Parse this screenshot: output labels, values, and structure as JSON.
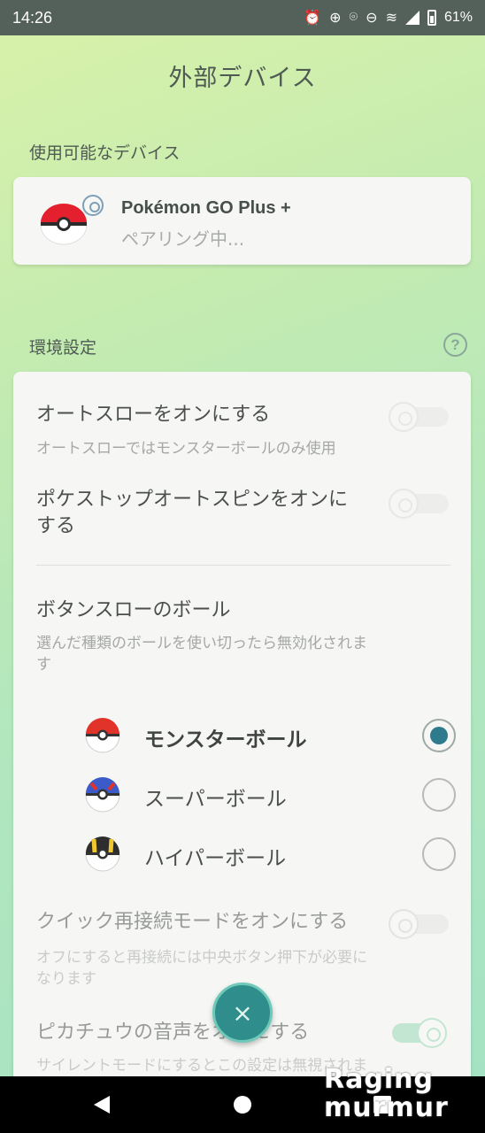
{
  "status_bar": {
    "time": "14:26",
    "battery": "61%",
    "icons": [
      "alarm-icon",
      "data-saver-icon",
      "location-icon",
      "do-not-disturb-icon",
      "wifi-icon",
      "signal-icon",
      "battery-icon"
    ]
  },
  "page": {
    "title": "外部デバイス"
  },
  "available_devices": {
    "label": "使用可能なデバイス",
    "device": {
      "name": "Pokémon GO Plus +",
      "status": "ペアリング中..."
    }
  },
  "settings": {
    "label": "環境設定",
    "help": "?",
    "auto_throw": {
      "title": "オートスローをオンにする",
      "desc": "オートスローではモンスターボールのみ使用",
      "enabled": false
    },
    "auto_spin": {
      "title_line1": "ポケストップオートスピンをオンに",
      "title_line2": "する",
      "enabled": false
    },
    "button_ball": {
      "title": "ボタンスローのボール",
      "desc_line1": "選んだ種類のボールを使い切ったら無効化されま",
      "desc_line2": "す",
      "options": [
        {
          "label": "モンスターボール",
          "selected": true
        },
        {
          "label": "スーパーボール",
          "selected": false
        },
        {
          "label": "ハイパーボール",
          "selected": false
        }
      ]
    },
    "quick_reconnect": {
      "title": "クイック再接続モードをオンにする",
      "desc_line1": "オフにすると再接続には中央ボタン押下が必要に",
      "desc_line2": "なります",
      "enabled": false
    },
    "pikachu_voice": {
      "title": "ピカチュウの音声をオンにする",
      "desc": "サイレントモードにするとこの設定は無視されま",
      "enabled": true
    }
  },
  "close_button": "×",
  "watermark": {
    "line1": "Raging",
    "line2": "murmur"
  },
  "colors": {
    "accent": "#2f7b8e",
    "fab": "#2f8d8b",
    "toggle_on": "#9bd9b6"
  }
}
